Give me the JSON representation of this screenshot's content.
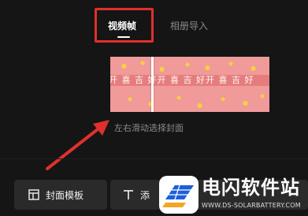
{
  "tabs": {
    "active_label": "视频帧",
    "inactive_label": "相册导入"
  },
  "strip": {
    "text": "开  喜  吉  好开  喜  吉  好开  喜  吉  好"
  },
  "hint": "左右滑动选择封面",
  "buttons": {
    "template_label": "封面模板",
    "text_label": "添"
  },
  "watermark": {
    "title": "电闪软件站",
    "url": "WWW.DS-SOLARBATTERY.COM"
  },
  "colors": {
    "background": "#151515",
    "annotation_red": "#e0302d",
    "strip_pink": "#f09a9a",
    "hint_gray": "#8c8c8c"
  },
  "icons": {
    "template": "layout-template-icon",
    "text": "text-icon",
    "logo": "solar-panel-logo-icon"
  }
}
